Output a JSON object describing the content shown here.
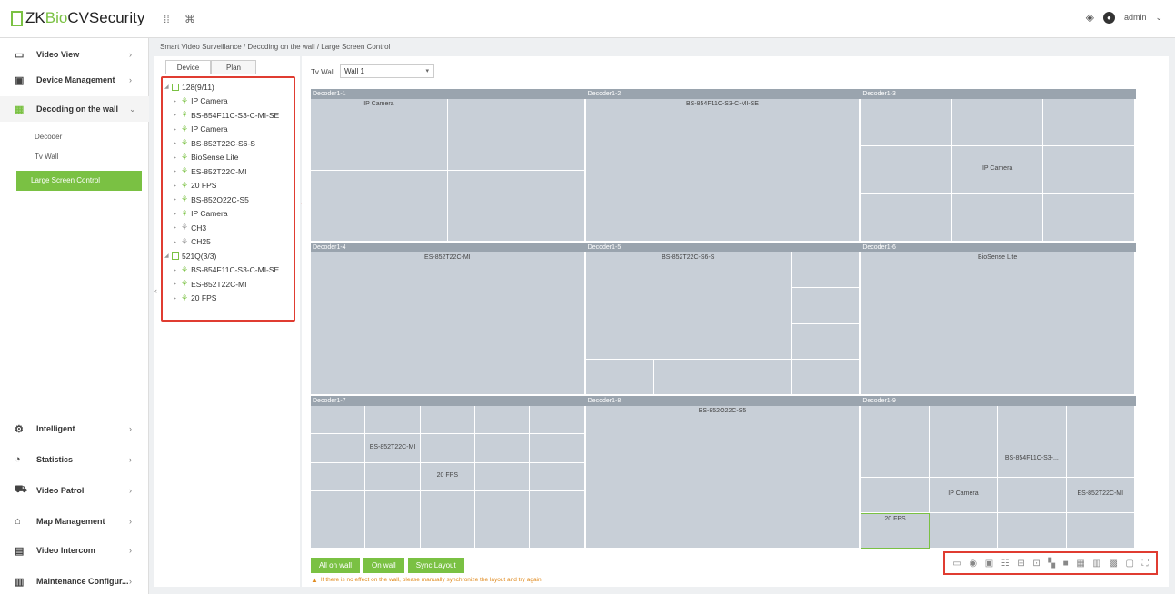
{
  "app": {
    "logo_zk": "ZK",
    "logo_bio": "Bio",
    "logo_rest": " CVSecurity",
    "user": "admin"
  },
  "breadcrumb": "Smart Video Surveillance / Decoding on the wall / Large Screen Control",
  "sidebar": {
    "items": [
      {
        "label": "Video View",
        "icon": "video-view-icon",
        "glyph": "▭"
      },
      {
        "label": "Device Management",
        "icon": "device-icon",
        "glyph": "▣"
      },
      {
        "label": "Decoding on the wall",
        "icon": "decoding-icon",
        "glyph": "▦"
      }
    ],
    "subitems": [
      "Decoder",
      "Tv Wall",
      "Large Screen Control"
    ],
    "bottom": [
      {
        "label": "Intelligent",
        "icon": "intelligent-icon",
        "glyph": "⚙"
      },
      {
        "label": "Statistics",
        "icon": "statistics-icon",
        "glyph": "◔"
      },
      {
        "label": "Video Patrol",
        "icon": "patrol-icon",
        "glyph": "⛟"
      },
      {
        "label": "Map Management",
        "icon": "map-icon",
        "glyph": "⌂"
      },
      {
        "label": "Video Intercom",
        "icon": "intercom-icon",
        "glyph": "▤"
      },
      {
        "label": "Maintenance Configur...",
        "icon": "maintenance-icon",
        "glyph": "▥"
      }
    ]
  },
  "tabs": [
    "Device",
    "Plan"
  ],
  "tree": [
    {
      "label": "128(9/11)",
      "level": 1,
      "type": "folder"
    },
    {
      "label": "IP Camera",
      "level": 2,
      "type": "cam"
    },
    {
      "label": "BS-854F11C-S3-C-MI-SE",
      "level": 2,
      "type": "cam"
    },
    {
      "label": "IP Camera",
      "level": 2,
      "type": "cam"
    },
    {
      "label": "BS-852T22C-S6-S",
      "level": 2,
      "type": "cam"
    },
    {
      "label": "BioSense Lite",
      "level": 2,
      "type": "cam"
    },
    {
      "label": "ES-852T22C-MI",
      "level": 2,
      "type": "cam"
    },
    {
      "label": "20 FPS",
      "level": 2,
      "type": "cam"
    },
    {
      "label": "BS-852O22C-S5",
      "level": 2,
      "type": "cam"
    },
    {
      "label": "IP Camera",
      "level": 2,
      "type": "cam"
    },
    {
      "label": "CH3",
      "level": 2,
      "type": "off"
    },
    {
      "label": "CH25",
      "level": 2,
      "type": "off"
    },
    {
      "label": "521Q(3/3)",
      "level": 1,
      "type": "folder"
    },
    {
      "label": "BS-854F11C-S3-C-MI-SE",
      "level": 2,
      "type": "cam"
    },
    {
      "label": "ES-852T22C-MI",
      "level": 2,
      "type": "cam"
    },
    {
      "label": "20 FPS",
      "level": 2,
      "type": "cam"
    }
  ],
  "tvwall": {
    "label": "Tv Wall",
    "value": "Wall 1"
  },
  "decoders": [
    "Decoder1-1",
    "Decoder1-2",
    "Decoder1-3",
    "Decoder1-4",
    "Decoder1-5",
    "Decoder1-6",
    "Decoder1-7",
    "Decoder1-8",
    "Decoder1-9"
  ],
  "cell_labels": {
    "d1": "IP Camera",
    "d2": "BS-854F11C-S3-C-MI-SE",
    "d3": "IP Camera",
    "d4": "ES-852T22C-MI",
    "d5": "BS-852T22C-S6-S",
    "d6": "BioSense Lite",
    "d7a": "ES-852T22C-MI",
    "d7b": "20 FPS",
    "d8": "BS-852O22C-S5",
    "d9a": "BS-854F11C-S3-...",
    "d9b": "IP Camera",
    "d9c": "ES-852T22C-MI",
    "d9d": "20 FPS"
  },
  "buttons": {
    "all_on_wall": "All on wall",
    "on_wall": "On wall",
    "sync": "Sync Layout"
  },
  "warning": "If there is no effect on the wall, please manually synchronize the layout and try again",
  "colors": {
    "accent": "#7ac143",
    "highlight": "#e03c31"
  }
}
